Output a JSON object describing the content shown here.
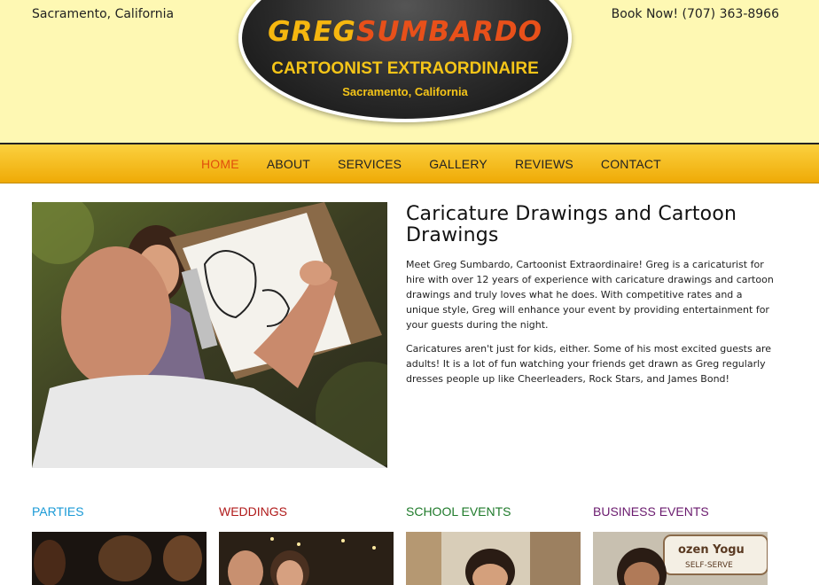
{
  "header": {
    "location": "Sacramento, California",
    "booking": "Book Now! (707) 363-8966",
    "logo": {
      "first_name": "GREG",
      "last_name": "SUMBARDO",
      "tagline": "CARTOONIST EXTRAORDINAIRE",
      "city": "Sacramento, California"
    }
  },
  "nav": {
    "items": [
      {
        "label": "HOME",
        "active": true
      },
      {
        "label": "ABOUT"
      },
      {
        "label": "SERVICES"
      },
      {
        "label": "GALLERY"
      },
      {
        "label": "REVIEWS"
      },
      {
        "label": "CONTACT"
      }
    ]
  },
  "main": {
    "heading": "Caricature Drawings and Cartoon Drawings",
    "paragraphs": [
      "Meet Greg Sumbardo, Cartoonist Extraordinaire! Greg is a caricaturist for hire with over 12 years of experience with caricature drawings and cartoon drawings and truly loves what he does. With competitive rates and a unique style, Greg will enhance your event by providing entertainment for your guests during the night.",
      "Caricatures aren't just for kids, either. Some of his most excited guests are adults! It is a lot of fun watching your friends get drawn as Greg regularly dresses people up like Cheerleaders, Rock Stars, and James Bond!"
    ]
  },
  "categories": [
    {
      "title": "PARTIES",
      "color": "#1a9ad6"
    },
    {
      "title": "WEDDINGS",
      "color": "#b01a1a"
    },
    {
      "title": "SCHOOL EVENTS",
      "color": "#1e7a2a"
    },
    {
      "title": "BUSINESS EVENTS",
      "color": "#6a1a6e"
    }
  ],
  "images": {
    "category_4_sign_line1": "ozen Yogu",
    "category_4_sign_line2": "SELF-SERVE"
  }
}
